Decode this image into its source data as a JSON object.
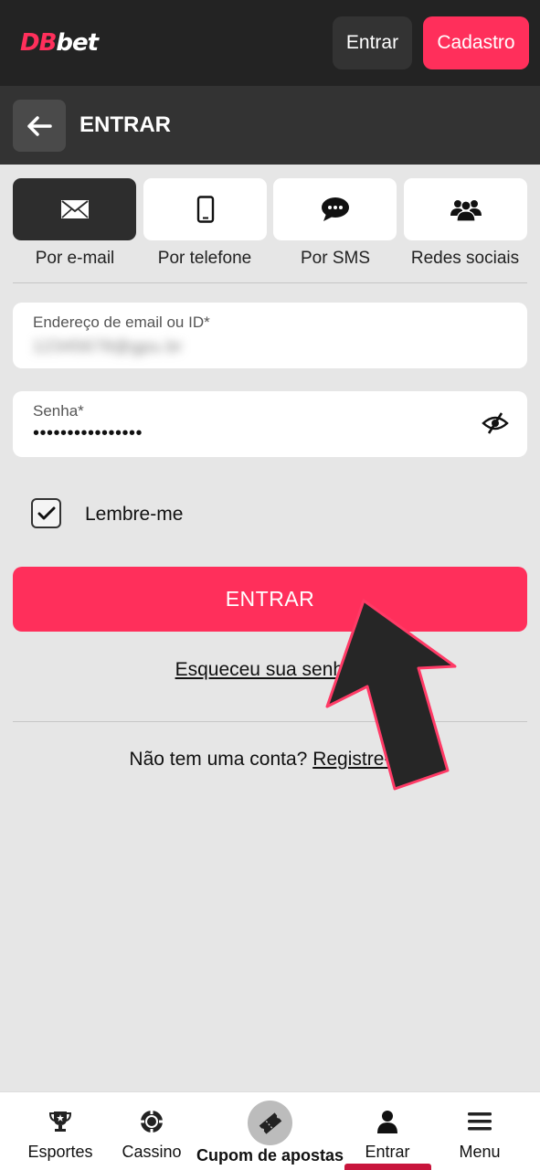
{
  "header": {
    "logo_db": "DB",
    "logo_bet": "bet",
    "login_label": "Entrar",
    "register_label": "Cadastro"
  },
  "titlebar": {
    "title": "ENTRAR"
  },
  "methods": [
    {
      "label": "Por e-mail",
      "icon": "envelope-icon",
      "active": true
    },
    {
      "label": "Por telefone",
      "icon": "phone-icon",
      "active": false
    },
    {
      "label": "Por SMS",
      "icon": "chat-bubble-icon",
      "active": false
    },
    {
      "label": "Redes sociais",
      "icon": "users-icon",
      "active": false
    }
  ],
  "form": {
    "email_label": "Endereço de email ou ID*",
    "email_value": "12345678@gpu.br",
    "password_label": "Senha*",
    "password_value": "••••••••••••••••",
    "remember_label": "Lembre-me",
    "remember_checked": true,
    "submit_label": "ENTRAR",
    "forgot_label": "Esqueceu sua senha?",
    "no_account_text": "Não tem uma conta? ",
    "register_link": "Registre-se"
  },
  "bottom_nav": {
    "items": [
      {
        "label": "Esportes",
        "icon": "trophy-icon"
      },
      {
        "label": "Cassino",
        "icon": "casino-chip-icon"
      },
      {
        "label": "Cupom de apostas",
        "icon": "ticket-icon"
      },
      {
        "label": "Entrar",
        "icon": "user-icon",
        "active": true
      },
      {
        "label": "Menu",
        "icon": "hamburger-menu-icon"
      }
    ]
  },
  "colors": {
    "brand": "#ff2f5b",
    "header_bg": "#232323",
    "page_bg": "#e6e6e6",
    "active_indicator": "#c8153c"
  }
}
